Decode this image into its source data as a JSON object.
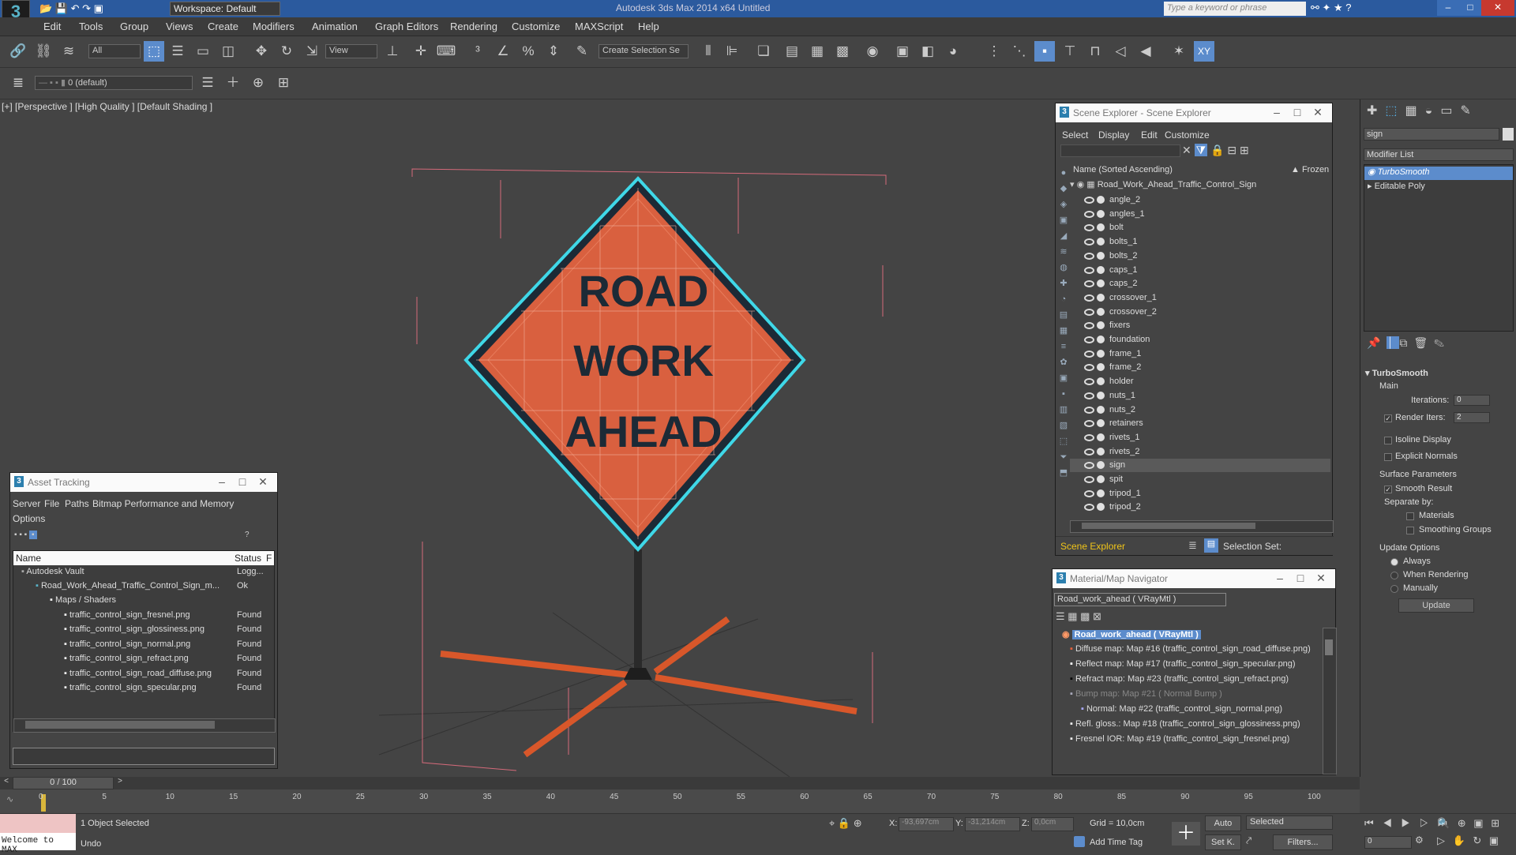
{
  "titlebar": {
    "workspace": "Workspace: Default",
    "title": "Autodesk 3ds Max 2014 x64     Untitled",
    "search_placeholder": "Type a keyword or phrase",
    "minimize": "–",
    "maximize": "□",
    "close": "✕"
  },
  "menu": [
    "Edit",
    "Tools",
    "Group",
    "Views",
    "Create",
    "Modifiers",
    "Animation",
    "Graph Editors",
    "Rendering",
    "Customize",
    "MAXScript",
    "Help"
  ],
  "toolbar": {
    "filter": "All",
    "view": "View",
    "selset": "Create Selection Se",
    "layer": "0 (default)"
  },
  "viewport": {
    "label": "[+] [Perspective ] [High Quality ] [Default Shading ]",
    "sign_lines": [
      "ROAD",
      "WORK",
      "AHEAD"
    ]
  },
  "scene_explorer": {
    "title": "Scene Explorer - Scene Explorer",
    "menu": [
      "Select",
      "Display",
      "Edit",
      "Customize"
    ],
    "col_name": "Name (Sorted Ascending)",
    "col_frozen": "▲ Frozen",
    "root": "Road_Work_Ahead_Traffic_Control_Sign",
    "items": [
      "angle_2",
      "angles_1",
      "bolt",
      "bolts_1",
      "bolts_2",
      "caps_1",
      "caps_2",
      "crossover_1",
      "crossover_2",
      "fixers",
      "foundation",
      "frame_1",
      "frame_2",
      "holder",
      "nuts_1",
      "nuts_2",
      "retainers",
      "rivets_1",
      "rivets_2",
      "sign",
      "spit",
      "tripod_1",
      "tripod_2"
    ],
    "selected": "sign",
    "footer_tab": "Scene Explorer",
    "footer_label": "Selection Set:"
  },
  "asset_tracking": {
    "title": "Asset Tracking",
    "menu": [
      "Server",
      "File",
      "Paths",
      "Bitmap Performance and Memory"
    ],
    "menu2": "Options",
    "col_name": "Name",
    "col_status": "Status",
    "col_extra": "F",
    "rows": [
      {
        "name": "Autodesk Vault",
        "status": "Logg..."
      },
      {
        "name": "Road_Work_Ahead_Traffic_Control_Sign_m...",
        "status": "Ok"
      },
      {
        "name": "Maps / Shaders",
        "status": ""
      },
      {
        "name": "traffic_control_sign_fresnel.png",
        "status": "Found"
      },
      {
        "name": "traffic_control_sign_glossiness.png",
        "status": "Found"
      },
      {
        "name": "traffic_control_sign_normal.png",
        "status": "Found"
      },
      {
        "name": "traffic_control_sign_refract.png",
        "status": "Found"
      },
      {
        "name": "traffic_control_sign_road_diffuse.png",
        "status": "Found"
      },
      {
        "name": "traffic_control_sign_specular.png",
        "status": "Found"
      }
    ],
    "help": "?"
  },
  "material_nav": {
    "title": "Material/Map Navigator",
    "field": "Road_work_ahead  ( VRayMtl )",
    "root": "Road_work_ahead  ( VRayMtl )",
    "items": [
      "Diffuse map: Map #16 (traffic_control_sign_road_diffuse.png)",
      "Reflect map: Map #17 (traffic_control_sign_specular.png)",
      "Refract map: Map #23 (traffic_control_sign_refract.png)",
      "Bump map: Map #21  ( Normal Bump )",
      "Normal: Map #22 (traffic_control_sign_normal.png)",
      "Refl. gloss.: Map #18 (traffic_control_sign_glossiness.png)",
      "Fresnel IOR: Map #19 (traffic_control_sign_fresnel.png)"
    ]
  },
  "command_panel": {
    "name_field": "sign",
    "modifier_list": "Modifier List",
    "stack": [
      "TurboSmooth",
      "Editable Poly"
    ],
    "rollout": "TurboSmooth",
    "main": "Main",
    "iterations_label": "Iterations:",
    "iterations": "0",
    "render_iters_label": "Render Iters:",
    "render_iters": "2",
    "isoline": "Isoline Display",
    "explicit": "Explicit Normals",
    "surface": "Surface Parameters",
    "smooth": "Smooth Result",
    "separate": "Separate by:",
    "materials": "Materials",
    "smoothing_groups": "Smoothing Groups",
    "update_options": "Update Options",
    "always": "Always",
    "when_rendering": "When Rendering",
    "manually": "Manually",
    "update_btn": "Update"
  },
  "timeline": {
    "frame": "0 / 100",
    "ticks": [
      "0",
      "5",
      "10",
      "15",
      "20",
      "25",
      "30",
      "35",
      "40",
      "45",
      "50",
      "55",
      "60",
      "65",
      "70",
      "75",
      "80",
      "85",
      "90",
      "95",
      "100"
    ]
  },
  "status": {
    "maxscript": "Welcome to MAX",
    "selected": "1 Object Selected",
    "undo": "Undo",
    "x_label": "X:",
    "x": "-93,697cm",
    "y_label": "Y:",
    "y": "-31,214cm",
    "z_label": "Z:",
    "z": "0,0cm",
    "grid": "Grid = 10,0cm",
    "add_time_tag": "Add Time Tag",
    "auto": "Auto",
    "selected_dd": "Selected",
    "setk": "Set K.",
    "filters": "Filters...",
    "frame_field": "0"
  }
}
